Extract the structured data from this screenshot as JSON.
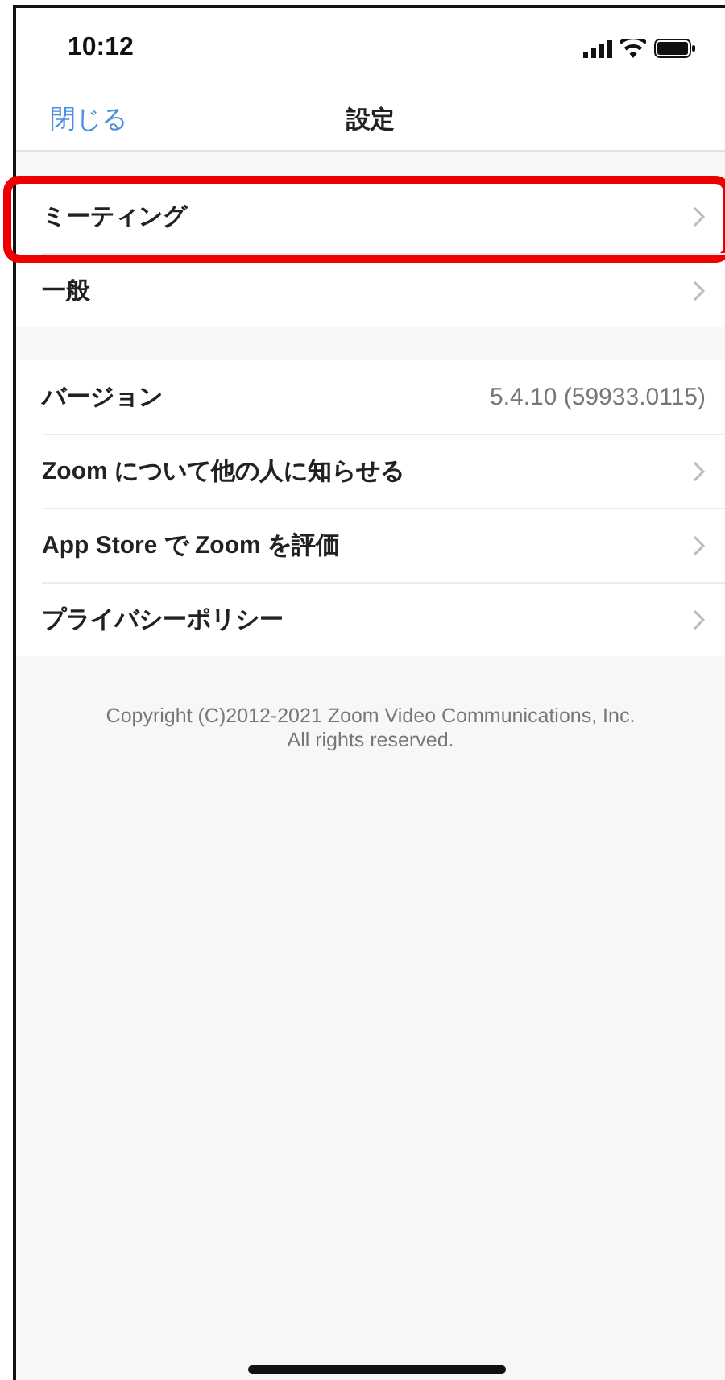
{
  "status_bar": {
    "time": "10:12"
  },
  "nav": {
    "close": "閉じる",
    "title": "設定"
  },
  "sections": [
    {
      "rows": [
        {
          "kind": "link",
          "label": "ミーティング",
          "highlighted": true
        },
        {
          "kind": "link",
          "label": "一般",
          "highlighted": false
        }
      ]
    },
    {
      "rows": [
        {
          "kind": "value",
          "label": "バージョン",
          "value": "5.4.10 (59933.0115)",
          "highlighted": false
        },
        {
          "kind": "link",
          "label": "Zoom について他の人に知らせる",
          "highlighted": false
        },
        {
          "kind": "link",
          "label": "App Store で Zoom を評価",
          "highlighted": false
        },
        {
          "kind": "link",
          "label": "プライバシーポリシー",
          "highlighted": false
        }
      ]
    }
  ],
  "footer": [
    "Copyright (C)2012-2021 Zoom Video Communications, Inc.",
    "All rights reserved."
  ]
}
